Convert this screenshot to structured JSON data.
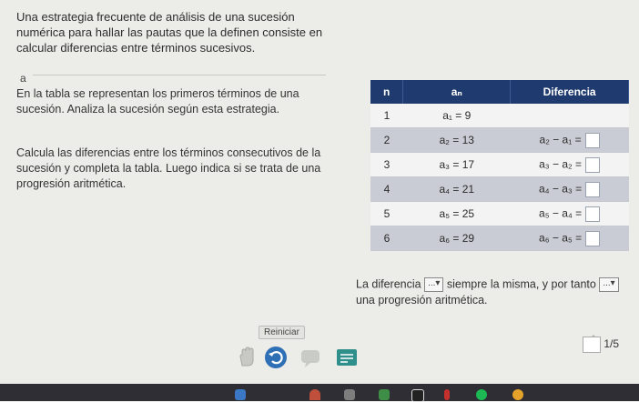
{
  "intro": "Una estrategia frecuente de análisis de una sucesión numérica para hallar las pautas que la definen consiste en calcular diferencias entre términos sucesivos.",
  "section_marker": "a",
  "paragraph1": "En la tabla se representan los primeros términos de una sucesión. Analiza la sucesión según esta estrategia.",
  "paragraph2": "Calcula las diferencias entre los términos consecutivos de la sucesión y completa la tabla. Luego indica si se trata de una progresión aritmética.",
  "table": {
    "headers": [
      "n",
      "aₙ",
      "Diferencia"
    ],
    "rows": [
      {
        "n": "1",
        "an": "a₁ = 9",
        "diff": ""
      },
      {
        "n": "2",
        "an": "a₂ = 13",
        "diff": "a₂ − a₁ ="
      },
      {
        "n": "3",
        "an": "a₃ = 17",
        "diff": "a₃ − a₂ ="
      },
      {
        "n": "4",
        "an": "a₄ = 21",
        "diff": "a₄ − a₃ ="
      },
      {
        "n": "5",
        "an": "a₅ = 25",
        "diff": "a₅ − a₄ ="
      },
      {
        "n": "6",
        "an": "a₆ = 29",
        "diff": "a₆ − a₅ ="
      }
    ]
  },
  "sentence": {
    "part1": "La diferencia",
    "dropdown1": "...▾",
    "part2": "siempre la misma, y por tanto",
    "dropdown2": "...▾",
    "part3": "una progresión aritmética."
  },
  "reset_label": "Reiniciar",
  "pagination": {
    "total": "/5",
    "current": "1"
  },
  "colors": {
    "header": "#1f3a6e",
    "accent_teal": "#2f8f8a"
  }
}
